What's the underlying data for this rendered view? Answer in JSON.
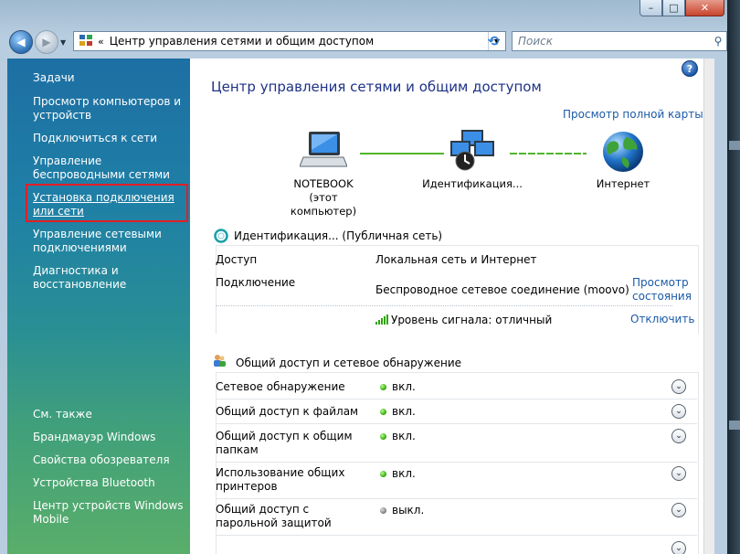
{
  "window": {
    "caption": {
      "minimize": "–",
      "maximize": "□",
      "close": "✕"
    }
  },
  "navbar": {
    "back_glyph": "◀",
    "forward_glyph": "▶",
    "dropdown_glyph": "▼",
    "address_separator": "«",
    "address": "Центр управления сетями и общим доступом",
    "refresh_glyph": "⟲",
    "search_placeholder": "Поиск",
    "search_glyph": "⚲"
  },
  "sidebar": {
    "tasks_header": "Задачи",
    "items": [
      {
        "label": "Просмотр компьютеров и устройств"
      },
      {
        "label": "Подключиться к сети"
      },
      {
        "label": "Управление беспроводными сетями"
      },
      {
        "label": "Установка подключения или сети"
      },
      {
        "label": "Управление сетевыми подключениями"
      },
      {
        "label": "Диагностика и восстановление"
      }
    ],
    "see_also_header": "См. также",
    "see_also": [
      {
        "label": "Брандмауэр Windows"
      },
      {
        "label": "Свойства обозревателя"
      },
      {
        "label": "Устройства Bluetooth"
      },
      {
        "label": "Центр устройств Windows Mobile"
      }
    ]
  },
  "main": {
    "help_glyph": "?",
    "title": "Центр управления сетями и общим доступом",
    "full_map_link": "Просмотр полной карты",
    "map": {
      "computer": {
        "name": "NOTEBOOK",
        "sub": "(этот компьютер)"
      },
      "network": {
        "name": "Идентификация..."
      },
      "internet": {
        "name": "Интернет"
      }
    },
    "network_section": {
      "title": "Идентификация... (Публичная сеть)",
      "access_label": "Доступ",
      "access_value": "Локальная сеть и Интернет",
      "connection_label": "Подключение",
      "connection_value": "Беспроводное сетевое соединение (moovo)",
      "view_status_link": "Просмотр состояния",
      "signal_value": "Уровень сигнала: отличный",
      "disconnect_link": "Отключить"
    },
    "sharing_section": {
      "title": "Общий доступ и сетевое обнаружение",
      "rows": [
        {
          "label": "Сетевое обнаружение",
          "state": "вкл.",
          "on": true
        },
        {
          "label": "Общий доступ к файлам",
          "state": "вкл.",
          "on": true
        },
        {
          "label": "Общий доступ к общим папкам",
          "state": "вкл.",
          "on": true
        },
        {
          "label": "Использование общих принтеров",
          "state": "вкл.",
          "on": true
        },
        {
          "label": "Общий доступ с парольной защитой",
          "state": "выкл.",
          "on": false
        }
      ],
      "expand_glyph": "⌄"
    }
  },
  "colors": {
    "accent": "#1e3287",
    "link": "#1b5aa6",
    "highlight": "#e31e24",
    "on": "#2ca400"
  }
}
